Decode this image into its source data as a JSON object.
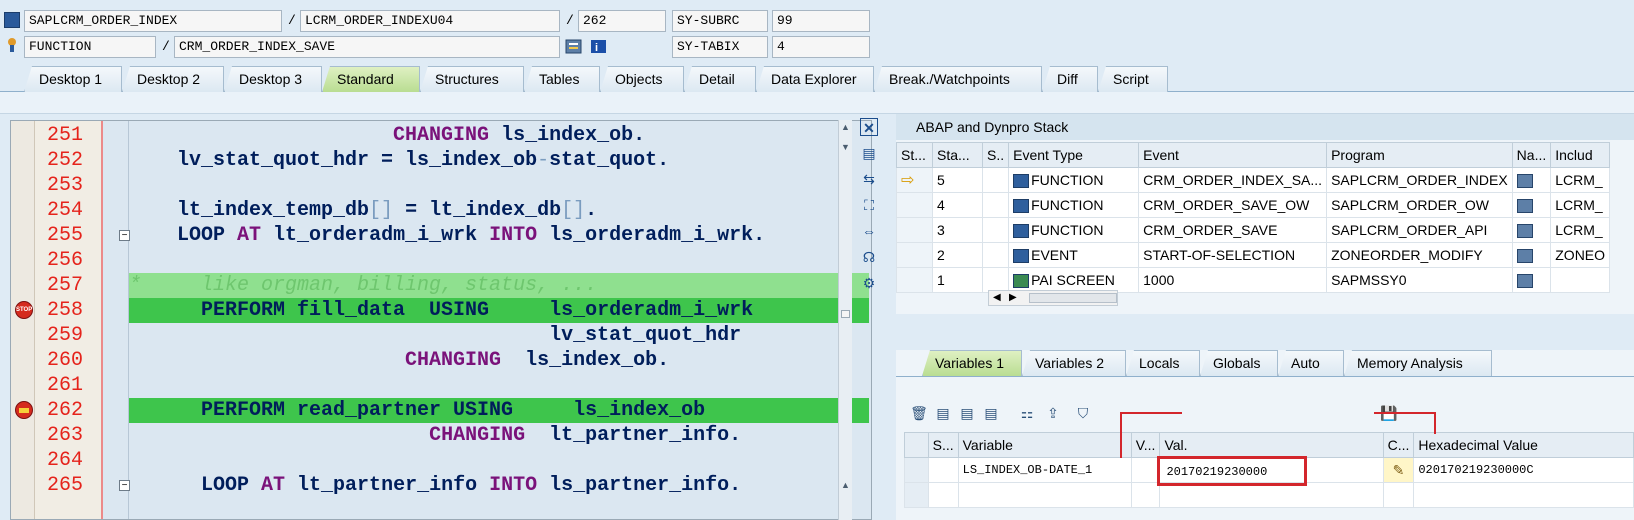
{
  "header": {
    "program": "SAPLCRM_ORDER_INDEX",
    "include": "LCRM_ORDER_INDEXU04",
    "line_no": "262",
    "subrc_label": "SY-SUBRC",
    "subrc_value": "99",
    "type": "FUNCTION",
    "function_name": "CRM_ORDER_INDEX_SAVE",
    "tabix_label": "SY-TABIX",
    "tabix_value": "4"
  },
  "tabs": [
    "Desktop 1",
    "Desktop 2",
    "Desktop 3",
    "Standard",
    "Structures",
    "Tables",
    "Objects",
    "Detail",
    "Data Explorer",
    "Break./Watchpoints",
    "Diff",
    "Script"
  ],
  "active_tab": "Standard",
  "source": {
    "lines": [
      {
        "num": "251",
        "parts": [
          {
            "t": "                      "
          },
          {
            "t": "CHANGING",
            "k": "kw"
          },
          {
            "t": " ls_index_ob."
          }
        ]
      },
      {
        "num": "252",
        "parts": [
          {
            "t": "    lv_stat_quot_hdr = ls_index_ob"
          },
          {
            "t": "-",
            "k": "op"
          },
          {
            "t": "stat_quot."
          }
        ]
      },
      {
        "num": "253",
        "parts": [
          {
            "t": ""
          }
        ]
      },
      {
        "num": "254",
        "parts": [
          {
            "t": "    lt_index_temp_db"
          },
          {
            "t": "[]",
            "k": "op"
          },
          {
            "t": " = lt_index_db"
          },
          {
            "t": "[]",
            "k": "op"
          },
          {
            "t": "."
          }
        ]
      },
      {
        "num": "255",
        "parts": [
          {
            "t": "    LOOP "
          },
          {
            "t": "AT",
            "k": "kw"
          },
          {
            "t": " lt_orderadm_i_wrk "
          },
          {
            "t": "INTO",
            "k": "kw"
          },
          {
            "t": " ls_orderadm_i_wrk."
          }
        ]
      },
      {
        "num": "256",
        "parts": [
          {
            "t": ""
          }
        ]
      },
      {
        "num": "257",
        "parts": [
          {
            "t": "*     like orgman, billing, status, ...",
            "k": "cmt-t"
          }
        ]
      },
      {
        "num": "258",
        "parts": [
          {
            "t": "      PERFORM fill_data  USING     ls_orderadm_i_wrk"
          }
        ]
      },
      {
        "num": "259",
        "parts": [
          {
            "t": "                                   lv_stat_quot_hdr"
          }
        ]
      },
      {
        "num": "260",
        "parts": [
          {
            "t": "                       "
          },
          {
            "t": "CHANGING",
            "k": "kw"
          },
          {
            "t": "  ls_index_ob."
          }
        ]
      },
      {
        "num": "261",
        "parts": [
          {
            "t": ""
          }
        ]
      },
      {
        "num": "262",
        "parts": [
          {
            "t": "      PERFORM read_partner USING     ls_index_ob"
          }
        ]
      },
      {
        "num": "263",
        "parts": [
          {
            "t": "                         "
          },
          {
            "t": "CHANGING",
            "k": "kw"
          },
          {
            "t": "  lt_partner_info."
          }
        ]
      },
      {
        "num": "264",
        "parts": [
          {
            "t": ""
          }
        ]
      },
      {
        "num": "265",
        "parts": [
          {
            "t": "      LOOP "
          },
          {
            "t": "AT",
            "k": "kw"
          },
          {
            "t": " lt_partner_info "
          },
          {
            "t": "INTO",
            "k": "kw"
          },
          {
            "t": " ls_partner_info."
          }
        ]
      }
    ]
  },
  "stack": {
    "title": "ABAP and Dynpro Stack",
    "columns": [
      "St...",
      "Sta...",
      "S..",
      "Event Type",
      "Event",
      "Program",
      "Na...",
      "Includ"
    ],
    "rows": [
      {
        "level": "5",
        "event_type": "FUNCTION",
        "event": "CRM_ORDER_INDEX_SA...",
        "program": "SAPLCRM_ORDER_INDEX",
        "include": "LCRM_",
        "current": true
      },
      {
        "level": "4",
        "event_type": "FUNCTION",
        "event": "CRM_ORDER_SAVE_OW",
        "program": "SAPLCRM_ORDER_OW",
        "include": "LCRM_",
        "current": false
      },
      {
        "level": "3",
        "event_type": "FUNCTION",
        "event": "CRM_ORDER_SAVE",
        "program": "SAPLCRM_ORDER_API",
        "include": "LCRM_",
        "current": false
      },
      {
        "level": "2",
        "event_type": "EVENT",
        "event": "START-OF-SELECTION",
        "program": "ZONEORDER_MODIFY",
        "include": "ZONEO",
        "current": false
      },
      {
        "level": "1",
        "event_type": "PAI SCREEN",
        "event": "1000",
        "program": "SAPMSSY0",
        "include": "",
        "current": false
      }
    ]
  },
  "var_tabs": [
    "Variables 1",
    "Variables 2",
    "Locals",
    "Globals",
    "Auto",
    "Memory Analysis"
  ],
  "active_var_tab": "Variables 1",
  "variables": {
    "columns": [
      "S...",
      "Variable",
      "V...",
      "Val.",
      "C...",
      "Hexadecimal Value"
    ],
    "rows": [
      {
        "variable": "LS_INDEX_OB-DATE_1",
        "value": "20170219230000",
        "hex": "020170219230000C"
      }
    ]
  }
}
